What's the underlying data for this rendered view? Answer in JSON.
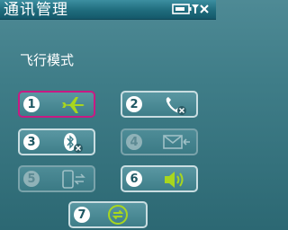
{
  "window": {
    "title": "通讯管理"
  },
  "status_icons": [
    "battery-icon",
    "signal-icon",
    "close-icon"
  ],
  "section": {
    "label": "飞行模式"
  },
  "buttons": [
    {
      "number": "1",
      "icon": "airplane-icon",
      "state": "selected"
    },
    {
      "number": "2",
      "icon": "phone-disabled-icon",
      "state": "enabled"
    },
    {
      "number": "3",
      "icon": "bluetooth-disabled-icon",
      "state": "enabled"
    },
    {
      "number": "4",
      "icon": "mail-icon",
      "state": "disabled"
    },
    {
      "number": "5",
      "icon": "device-sync-icon",
      "state": "disabled"
    },
    {
      "number": "6",
      "icon": "speaker-icon",
      "state": "enabled"
    },
    {
      "number": "7",
      "icon": "sync-icon",
      "state": "enabled"
    }
  ],
  "colors": {
    "background": "#3f7d88",
    "titlebar": "#1f6c7d",
    "selected_border": "#c81a83",
    "airplane": "#a8d61e",
    "sync": "#a8d61e"
  }
}
